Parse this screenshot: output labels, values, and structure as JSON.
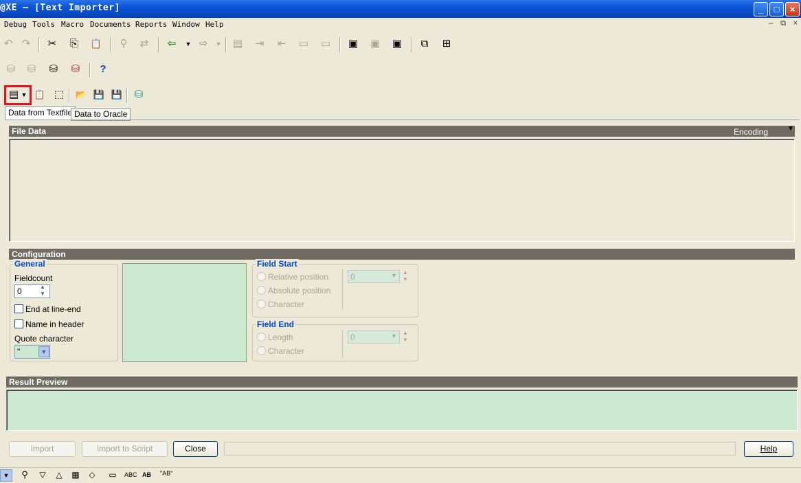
{
  "window": {
    "title": "@XE – [Text Importer]",
    "caption_buttons": {
      "minimize": "_",
      "maximize": "□",
      "close": "×"
    }
  },
  "menu": {
    "items": [
      "Debug",
      "Tools",
      "Macro",
      "Documents",
      "Reports",
      "Window",
      "Help"
    ],
    "mdi_buttons": {
      "minimize": "–",
      "restore": "⧉",
      "close": "×"
    }
  },
  "icons": {
    "undo": "↶",
    "redo": "↷",
    "cut": "✂",
    "copy": "⎘",
    "paste": "📋",
    "find": "⚲",
    "replace": "⇄",
    "import_arrow": "⇦",
    "export_arrow": "⇨",
    "help": "?",
    "open_file": "📂",
    "save": "💾"
  },
  "tabs": {
    "tab1": "Data from Textfile",
    "tab2": "Data to Oracle"
  },
  "file_data": {
    "title": "File Data",
    "encoding_label": "Encoding"
  },
  "configuration": {
    "title": "Configuration",
    "general": {
      "title": "General",
      "fieldcount_label": "Fieldcount",
      "fieldcount_value": "0",
      "end_at_line_end": "End at line-end",
      "name_in_header": "Name in header",
      "quote_character_label": "Quote character",
      "quote_character_value": "\""
    },
    "field_start": {
      "title": "Field Start",
      "relative_position": "Relative position",
      "absolute_position": "Absolute position",
      "character": "Character",
      "value": "0"
    },
    "field_end": {
      "title": "Field End",
      "length": "Length",
      "character": "Character",
      "value": "0"
    }
  },
  "result_preview": {
    "title": "Result Preview"
  },
  "buttons": {
    "import": "Import",
    "import_to_script": "Import to Script",
    "close": "Close",
    "help": "Help"
  },
  "statusbar": {
    "abc": "ABC",
    "ab_quote": "\"AB\""
  },
  "colors": {
    "green_panel": "#cde9d2",
    "bar": "#6f6b62",
    "group_title": "#0046d5",
    "highlight": "#e0141e"
  }
}
